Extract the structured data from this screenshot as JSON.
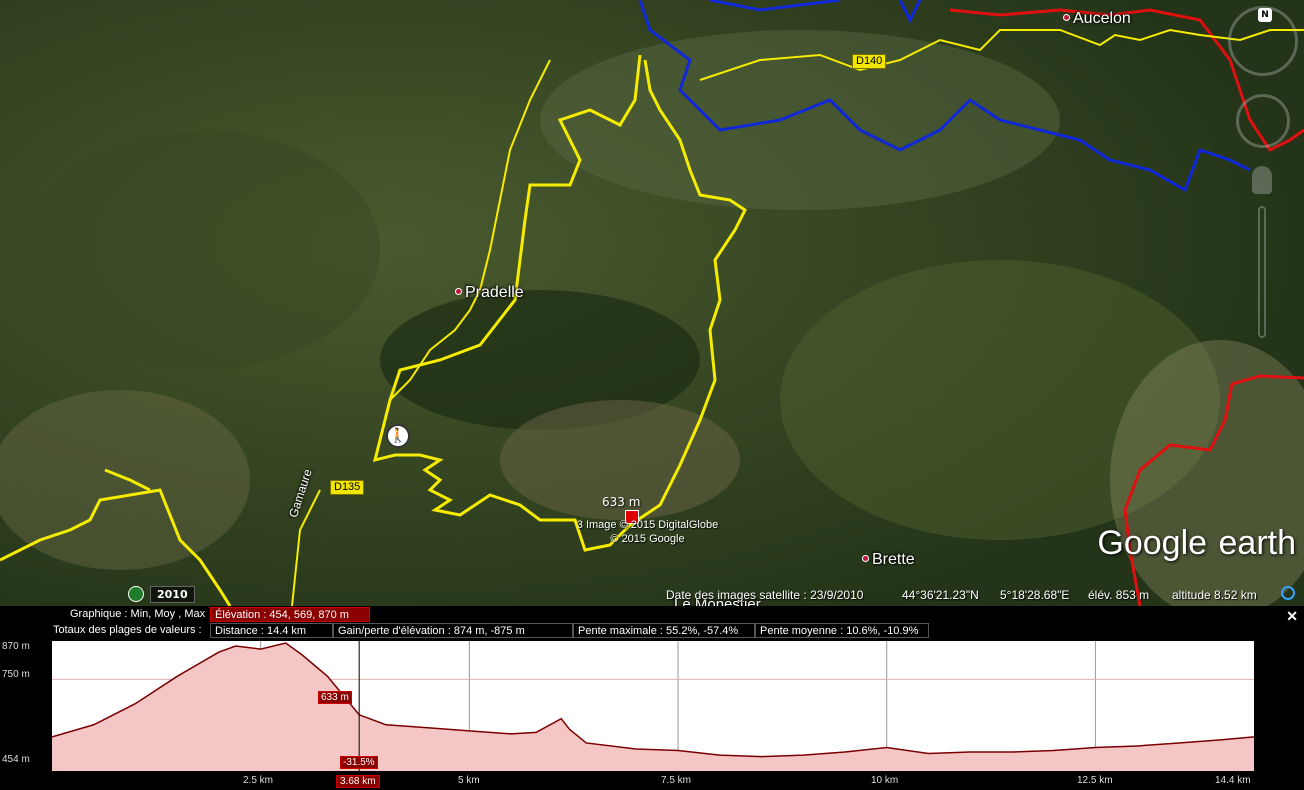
{
  "map": {
    "places": {
      "aucelon": "Aucelon",
      "pradelle": "Pradelle",
      "brette": "Brette",
      "le_monestier": "Le Monestier"
    },
    "roads": {
      "d140": "D140",
      "d135": "D135",
      "gamaure": "Gamaure"
    },
    "marker_altitude": "633 m",
    "copyright_line1": "3 Image © 2015 DigitalGlobe",
    "copyright_line2": "© 2015 Google",
    "logo_google": "Google",
    "logo_earth": "earth",
    "compass_north": "N",
    "historical_year": "2010",
    "status": {
      "date": "Date des images satellite : 23/9/2010",
      "lat": "44°36'21.23\"N",
      "lon": "5°18'28.68\"E",
      "elev": "élév.   853 m",
      "altitude": "altitude   8.52 km"
    },
    "colors": {
      "track": "#f5ec00",
      "blue_track": "#1028d8",
      "red_track": "#e01010"
    },
    "icons": [
      "hiker-icon",
      "compass-icon",
      "historical-imagery-icon",
      "street-view-icon",
      "zoom-slider-icon",
      "close-icon"
    ]
  },
  "profile": {
    "graph_label": "Graphique : Min, Moy , Max",
    "elevation": "Élévation : 454, 569, 870 m",
    "totals_label": "Totaux des plages de valeurs :",
    "distance": "Distance : 14.4 km",
    "gain_loss": "Gain/perte d'élévation : 874 m, -875 m",
    "max_slope": "Pente maximale : 55.2%, -57.4%",
    "avg_slope": "Pente moyenne : 10.6%, -10.9%",
    "y_labels": [
      "870 m",
      "750 m",
      "454 m"
    ],
    "x_labels": [
      "2.5 km",
      "5 km",
      "7.5 km",
      "10 km",
      "12.5 km",
      "14.4 km"
    ],
    "cursor": {
      "distance_label": "3.68 km",
      "elevation_label": "633 m",
      "slope_label": "-31.5%",
      "distance_km": 3.68,
      "elevation_m": 633
    },
    "chart_data": {
      "type": "area",
      "x": [
        0,
        0.5,
        1.0,
        1.5,
        2.0,
        2.2,
        2.5,
        2.8,
        3.0,
        3.3,
        3.68,
        4.0,
        4.5,
        5.0,
        5.5,
        5.8,
        6.1,
        6.2,
        6.4,
        7.0,
        7.5,
        8.0,
        8.5,
        9.0,
        9.5,
        10.0,
        10.5,
        11.0,
        11.5,
        12.0,
        12.5,
        13.0,
        13.5,
        14.0,
        14.4
      ],
      "y": [
        560,
        600,
        670,
        760,
        840,
        860,
        850,
        870,
        830,
        760,
        633,
        600,
        590,
        580,
        570,
        575,
        620,
        585,
        540,
        520,
        515,
        500,
        495,
        500,
        510,
        525,
        505,
        510,
        510,
        515,
        525,
        530,
        540,
        550,
        560
      ],
      "xlim": [
        0,
        14.4
      ],
      "ylim": [
        454,
        870
      ],
      "fill_color": "#f4c6c6",
      "line_color": "#7a0000"
    }
  }
}
